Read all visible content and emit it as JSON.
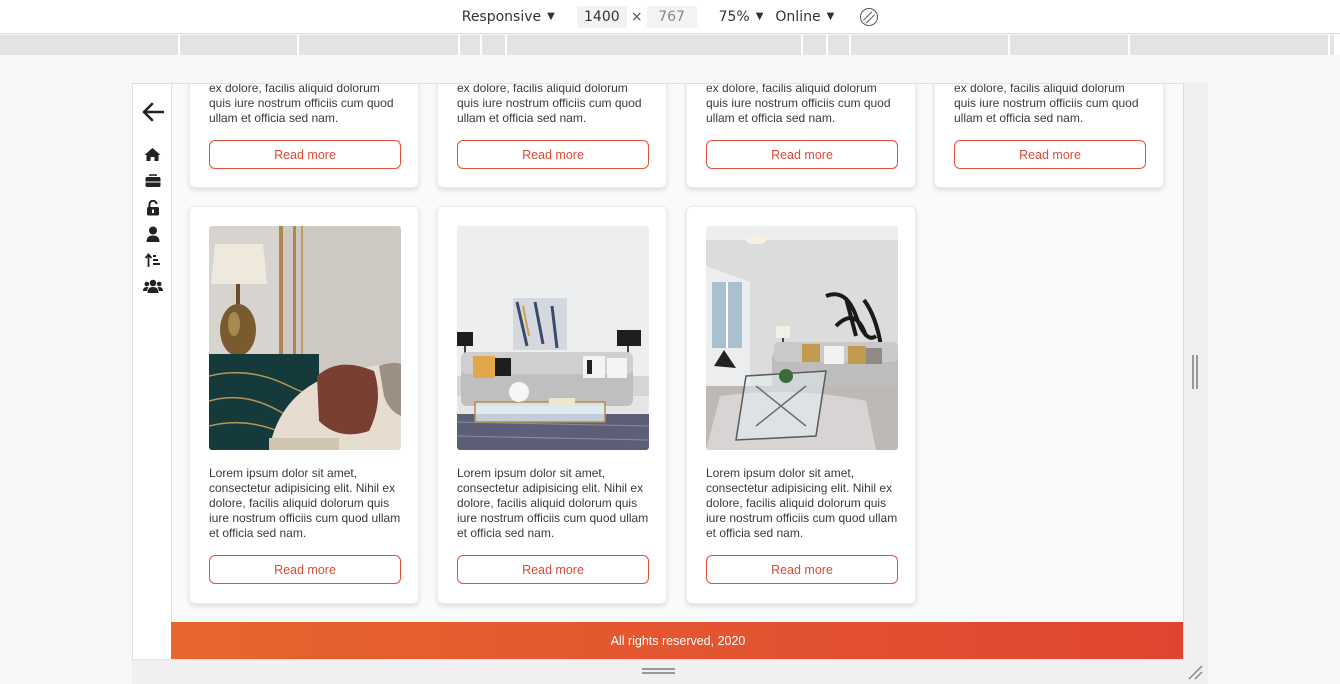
{
  "devtools": {
    "device": "Responsive",
    "width": "1400",
    "times": "×",
    "height": "767",
    "zoom": "75%",
    "network": "Online",
    "rotate_icon": "rotate-icon"
  },
  "sidebar": {
    "icons": [
      "arrow-left-icon",
      "home-icon",
      "briefcase-icon",
      "unlock-icon",
      "user-icon",
      "sort-icon",
      "users-icon"
    ]
  },
  "cards_top": [
    {
      "text": "ex dolore, facilis aliquid dolorum quis iure nostrum officiis cum quod ullam et officia sed nam.",
      "button": "Read more"
    },
    {
      "text": "ex dolore, facilis aliquid dolorum quis iure nostrum officiis cum quod ullam et officia sed nam.",
      "button": "Read more"
    },
    {
      "text": "ex dolore, facilis aliquid dolorum quis iure nostrum officiis cum quod ullam et officia sed nam.",
      "button": "Read more"
    },
    {
      "text": "ex dolore, facilis aliquid dolorum quis iure nostrum officiis cum quod ullam et officia sed nam.",
      "button": "Read more"
    }
  ],
  "cards_bottom": [
    {
      "text": "Lorem ipsum dolor sit amet, consectetur adipisicing elit. Nihil ex dolore, facilis aliquid dolorum quis iure nostrum officiis cum quod ullam et officia sed nam.",
      "button": "Read more"
    },
    {
      "text": "Lorem ipsum dolor sit amet, consectetur adipisicing elit. Nihil ex dolore, facilis aliquid dolorum quis iure nostrum officiis cum quod ullam et officia sed nam.",
      "button": "Read more"
    },
    {
      "text": "Lorem ipsum dolor sit amet, consectetur adipisicing elit. Nihil ex dolore, facilis aliquid dolorum quis iure nostrum officiis cum quod ullam et officia sed nam.",
      "button": "Read more"
    }
  ],
  "footer": {
    "text": "All rights reserved, 2020"
  },
  "colors": {
    "accent": "#e3503a",
    "footer_start": "#e8652f",
    "footer_end": "#df4630"
  }
}
